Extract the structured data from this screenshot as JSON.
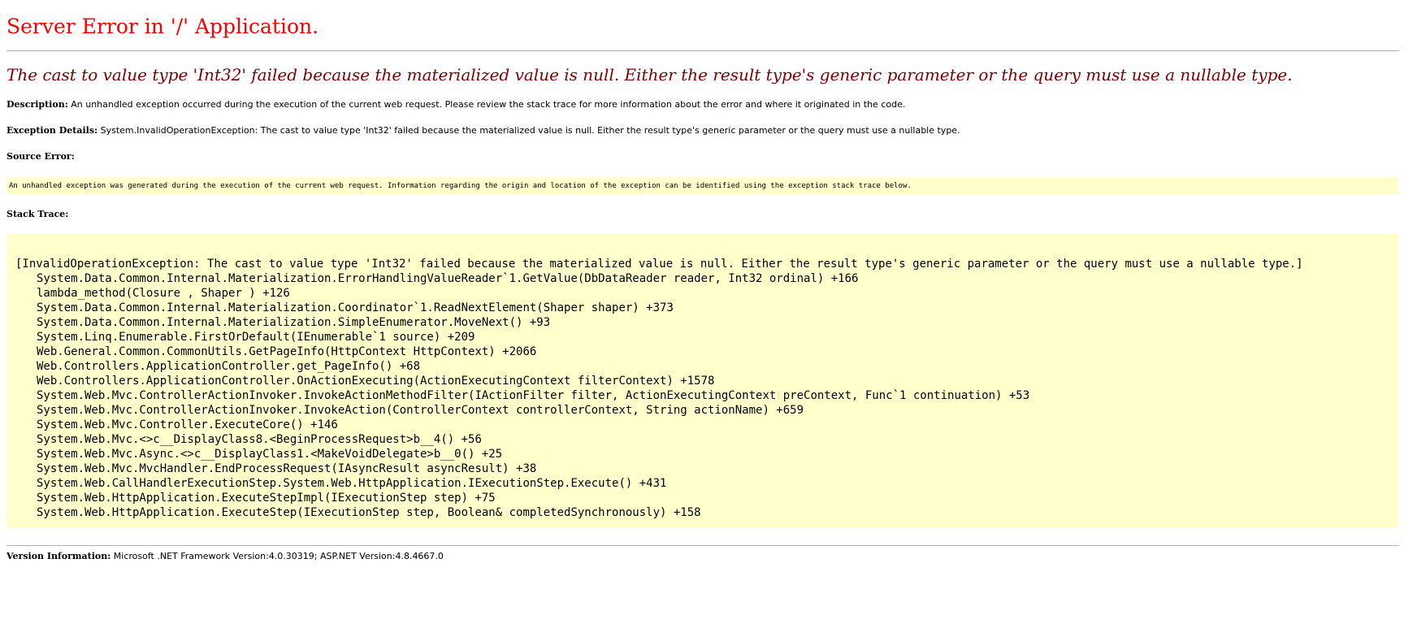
{
  "title": "Server Error in '/' Application.",
  "message": "The cast to value type 'Int32' failed because the materialized value is null. Either the result type's generic parameter or the query must use a nullable type.",
  "description": {
    "label": "Description:",
    "text": "An unhandled exception occurred during the execution of the current web request. Please review the stack trace for more information about the error and where it originated in the code."
  },
  "exception_details": {
    "label": "Exception Details:",
    "text": "System.InvalidOperationException: The cast to value type 'Int32' failed because the materialized value is null. Either the result type's generic parameter or the query must use a nullable type."
  },
  "source_error": {
    "label": "Source Error:",
    "text": "An unhandled exception was generated during the execution of the current web request. Information regarding the origin and location of the exception can be identified using the exception stack trace below."
  },
  "stack_trace": {
    "label": "Stack Trace:",
    "head": "[InvalidOperationException: The cast to value type 'Int32' failed because the materialized value is null. Either the result type's generic parameter or the query must use a nullable type.]",
    "lines": [
      "System.Data.Common.Internal.Materialization.ErrorHandlingValueReader`1.GetValue(DbDataReader reader, Int32 ordinal) +166",
      "lambda_method(Closure , Shaper ) +126",
      "System.Data.Common.Internal.Materialization.Coordinator`1.ReadNextElement(Shaper shaper) +373",
      "System.Data.Common.Internal.Materialization.SimpleEnumerator.MoveNext() +93",
      "System.Linq.Enumerable.FirstOrDefault(IEnumerable`1 source) +209",
      "Web.General.Common.CommonUtils.GetPageInfo(HttpContext HttpContext) +2066",
      "Web.Controllers.ApplicationController.get_PageInfo() +68",
      "Web.Controllers.ApplicationController.OnActionExecuting(ActionExecutingContext filterContext) +1578",
      "System.Web.Mvc.ControllerActionInvoker.InvokeActionMethodFilter(IActionFilter filter, ActionExecutingContext preContext, Func`1 continuation) +53",
      "System.Web.Mvc.ControllerActionInvoker.InvokeAction(ControllerContext controllerContext, String actionName) +659",
      "System.Web.Mvc.Controller.ExecuteCore() +146",
      "System.Web.Mvc.<>c__DisplayClass8.<BeginProcessRequest>b__4() +56",
      "System.Web.Mvc.Async.<>c__DisplayClass1.<MakeVoidDelegate>b__0() +25",
      "System.Web.Mvc.MvcHandler.EndProcessRequest(IAsyncResult asyncResult) +38",
      "System.Web.CallHandlerExecutionStep.System.Web.HttpApplication.IExecutionStep.Execute() +431",
      "System.Web.HttpApplication.ExecuteStepImpl(IExecutionStep step) +75",
      "System.Web.HttpApplication.ExecuteStep(IExecutionStep step, Boolean& completedSynchronously) +158"
    ]
  },
  "version_info": {
    "label": "Version Information:",
    "text": "Microsoft .NET Framework Version:4.0.30319; ASP.NET Version:4.8.4667.0"
  },
  "colors": {
    "title": "#ff0000",
    "message": "#800000",
    "code_background": "#ffffcc",
    "rule": "#b3b3b3"
  }
}
